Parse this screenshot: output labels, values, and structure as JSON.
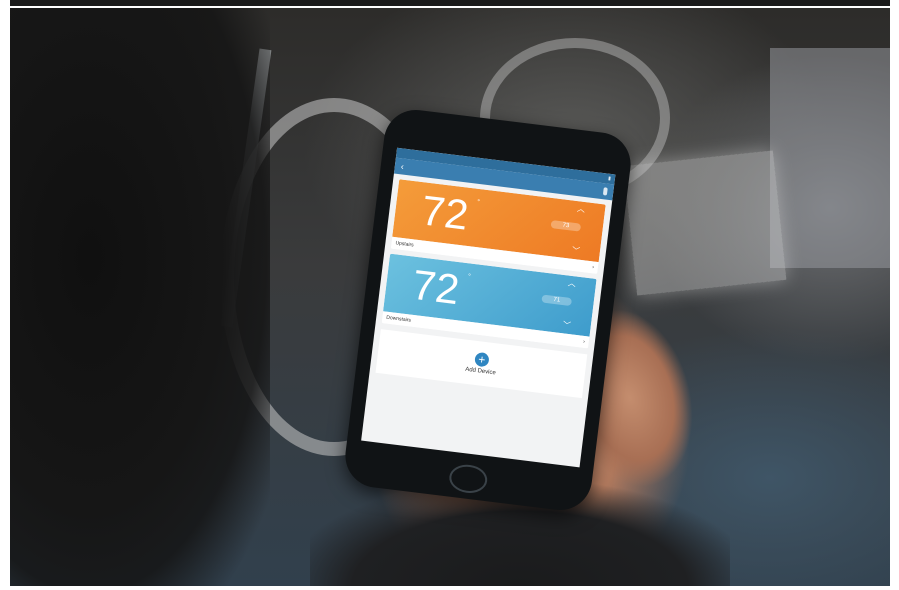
{
  "image": {
    "colors": {
      "upstairs_card": "#ee7a24",
      "downstairs_card": "#3e9ccc",
      "header": "#3a7eb0",
      "add_button": "#2f86c1"
    }
  },
  "app": {
    "title": "",
    "nav": {
      "back_icon": "chevron-left-icon"
    },
    "thermostats": [
      {
        "name": "Upstairs",
        "temperature": "72",
        "unit": "°",
        "setpoint": "73"
      },
      {
        "name": "Downstairs",
        "temperature": "72",
        "unit": "°",
        "setpoint": "71"
      }
    ],
    "add_device": {
      "label": "Add Device",
      "icon": "plus-icon"
    }
  }
}
